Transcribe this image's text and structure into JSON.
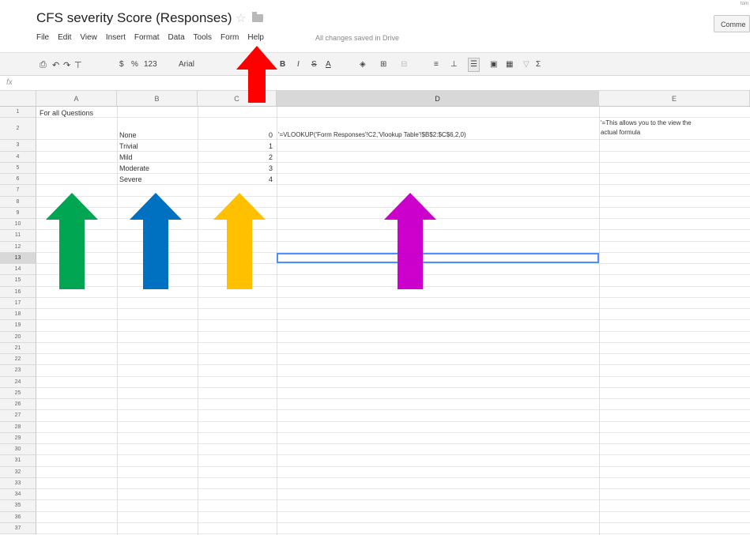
{
  "app": {
    "doc_title": "CFS severity Score (Responses)",
    "comments_label": "Comme",
    "corner_text": "tom"
  },
  "menu": {
    "items": [
      "File",
      "Edit",
      "View",
      "Insert",
      "Format",
      "Data",
      "Tools",
      "Form",
      "Help"
    ],
    "save_status": "All changes saved in Drive"
  },
  "toolbar": {
    "currency": "$",
    "percent": "%",
    "number_format": "123",
    "font": "Arial",
    "bold": "B",
    "italic": "I",
    "strike": "S",
    "text_color": "A",
    "sum": "Σ"
  },
  "formula_bar": {
    "label": "fx",
    "value": ""
  },
  "sheet": {
    "columns": [
      "A",
      "B",
      "C",
      "D",
      "E"
    ],
    "selected_column": "D",
    "selected_row": 13,
    "row_count": 37,
    "cells": {
      "A1": "For all Questions",
      "B2": "None",
      "B3": "Trivial",
      "B4": "Mild",
      "B5": "Moderate",
      "B6": "Severe",
      "C2": "0",
      "C3": "1",
      "C4": "2",
      "C5": "3",
      "C6": "4",
      "D2": "'=VLOOKUP('Form Responses'!C2,'Vlookup Table'!$B$2:$C$6,2,0)",
      "E2_line1": "'=This allows you to the view the",
      "E2_line2": "actual formula"
    }
  },
  "annotations": {
    "arrow_colors": {
      "form_menu": "#ff0000",
      "column_a": "#00a651",
      "column_b": "#0070c0",
      "column_c": "#ffc000",
      "column_d": "#cc00cc"
    },
    "selection_color": "#4d90fe"
  }
}
